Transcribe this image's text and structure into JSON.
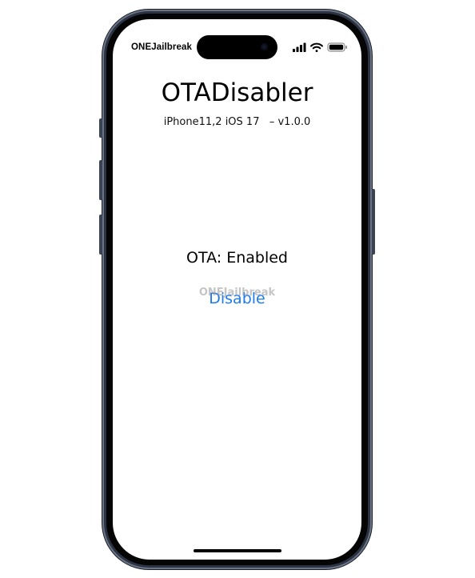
{
  "status_bar": {
    "carrier": "ONEJailbreak",
    "icons": [
      "cellular-signal-icon",
      "wifi-icon",
      "battery-icon"
    ]
  },
  "app": {
    "title": "OTADisabler",
    "subtitle": "iPhone11,2 iOS 17   – v1.0.0",
    "ota_status": "OTA: Enabled",
    "disable_label": "Disable",
    "watermark": "ONEJailbreak"
  },
  "colors": {
    "accent": "#1e7cf0",
    "frame": "#2c3444",
    "background": "#ffffff"
  }
}
